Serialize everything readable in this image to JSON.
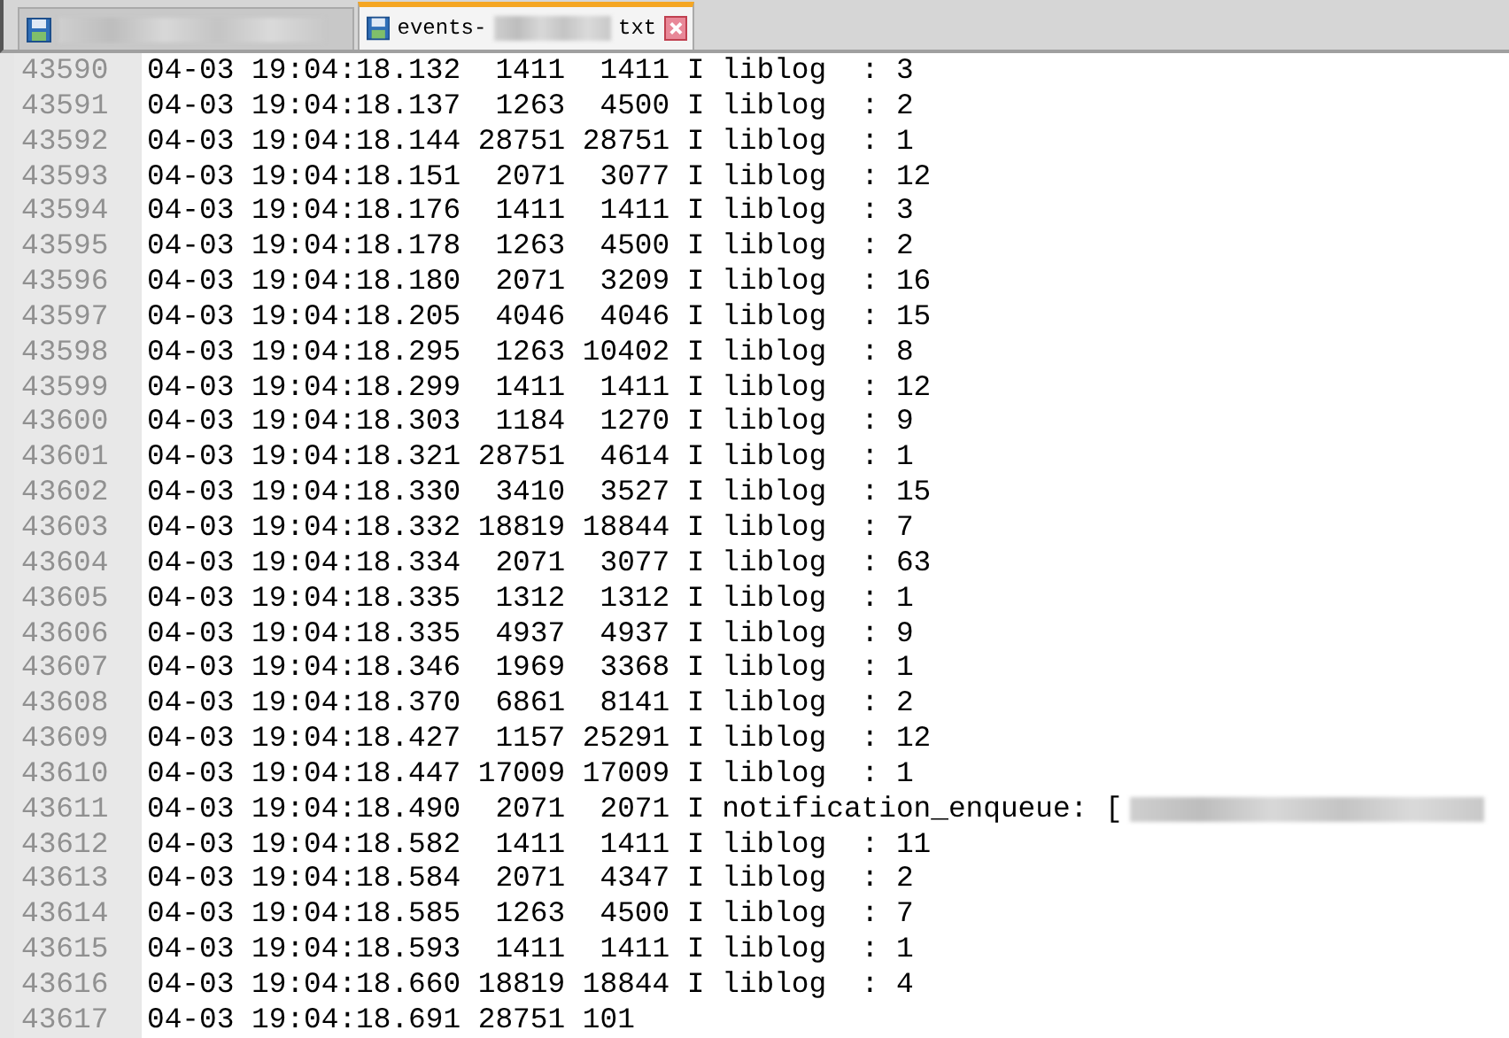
{
  "tabs": [
    {
      "selected": false,
      "blurred": true
    },
    {
      "selected": true,
      "label_start": "events-",
      "blurred": true,
      "label_end": "txt",
      "closable": true
    }
  ],
  "lines": [
    {
      "number": "43590",
      "text": "04-03 19:04:18.132  1411  1411 I liblog  : 3"
    },
    {
      "number": "43591",
      "text": "04-03 19:04:18.137  1263  4500 I liblog  : 2"
    },
    {
      "number": "43592",
      "text": "04-03 19:04:18.144 28751 28751 I liblog  : 1"
    },
    {
      "number": "43593",
      "text": "04-03 19:04:18.151  2071  3077 I liblog  : 12"
    },
    {
      "number": "43594",
      "text": "04-03 19:04:18.176  1411  1411 I liblog  : 3"
    },
    {
      "number": "43595",
      "text": "04-03 19:04:18.178  1263  4500 I liblog  : 2"
    },
    {
      "number": "43596",
      "text": "04-03 19:04:18.180  2071  3209 I liblog  : 16"
    },
    {
      "number": "43597",
      "text": "04-03 19:04:18.205  4046  4046 I liblog  : 15"
    },
    {
      "number": "43598",
      "text": "04-03 19:04:18.295  1263 10402 I liblog  : 8"
    },
    {
      "number": "43599",
      "text": "04-03 19:04:18.299  1411  1411 I liblog  : 12"
    },
    {
      "number": "43600",
      "text": "04-03 19:04:18.303  1184  1270 I liblog  : 9"
    },
    {
      "number": "43601",
      "text": "04-03 19:04:18.321 28751  4614 I liblog  : 1"
    },
    {
      "number": "43602",
      "text": "04-03 19:04:18.330  3410  3527 I liblog  : 15"
    },
    {
      "number": "43603",
      "text": "04-03 19:04:18.332 18819 18844 I liblog  : 7"
    },
    {
      "number": "43604",
      "text": "04-03 19:04:18.334  2071  3077 I liblog  : 63"
    },
    {
      "number": "43605",
      "text": "04-03 19:04:18.335  1312  1312 I liblog  : 1"
    },
    {
      "number": "43606",
      "text": "04-03 19:04:18.335  4937  4937 I liblog  : 9"
    },
    {
      "number": "43607",
      "text": "04-03 19:04:18.346  1969  3368 I liblog  : 1"
    },
    {
      "number": "43608",
      "text": "04-03 19:04:18.370  6861  8141 I liblog  : 2"
    },
    {
      "number": "43609",
      "text": "04-03 19:04:18.427  1157 25291 I liblog  : 12"
    },
    {
      "number": "43610",
      "text": "04-03 19:04:18.447 17009 17009 I liblog  : 1"
    },
    {
      "number": "43611",
      "text": "04-03 19:04:18.490  2071  2071 I notification_enqueue: [",
      "blurred_tail": true
    },
    {
      "number": "43612",
      "text": "04-03 19:04:18.582  1411  1411 I liblog  : 11"
    },
    {
      "number": "43613",
      "text": "04-03 19:04:18.584  2071  4347 I liblog  : 2"
    },
    {
      "number": "43614",
      "text": "04-03 19:04:18.585  1263  4500 I liblog  : 7"
    },
    {
      "number": "43615",
      "text": "04-03 19:04:18.593  1411  1411 I liblog  : 1"
    },
    {
      "number": "43616",
      "text": "04-03 19:04:18.660 18819 18844 I liblog  : 4"
    },
    {
      "number": "43617",
      "text": "04-03 19:04:18.691 28751 101"
    }
  ]
}
